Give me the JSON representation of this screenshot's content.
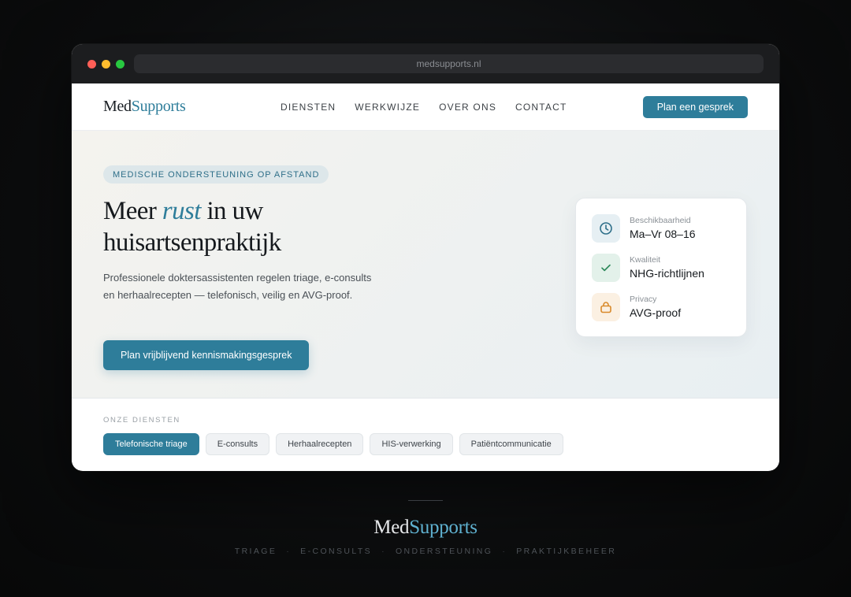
{
  "browser": {
    "url": "medsupports.nl"
  },
  "nav": {
    "logo_part1": "Med",
    "logo_part2": "Supports",
    "items": [
      {
        "label": "DIENSTEN"
      },
      {
        "label": "WERKWIJZE"
      },
      {
        "label": "OVER ONS"
      },
      {
        "label": "CONTACT"
      }
    ],
    "cta_label": "Plan een gesprek"
  },
  "hero": {
    "eyebrow": "MEDISCHE ONDERSTEUNING OP AFSTAND",
    "headline_pre": "Meer ",
    "headline_emph": "rust",
    "headline_post": " in uw huisartsenpraktijk",
    "lead": "Professionele doktersassistenten regelen triage, e-consults en herhaalrecepten — telefonisch, veilig en AVG-proof.",
    "cta_label": "Plan vrijblijvend kennismakingsgesprek"
  },
  "card": {
    "rows": [
      {
        "label": "Beschikbaarheid",
        "value": "Ma–Vr 08–16",
        "icon": "clock-icon"
      },
      {
        "label": "Kwaliteit",
        "value": "NHG-richtlijnen",
        "icon": "check-icon"
      },
      {
        "label": "Privacy",
        "value": "AVG-proof",
        "icon": "lock-icon"
      }
    ]
  },
  "services": {
    "label": "ONZE DIENSTEN",
    "chips": [
      {
        "label": "Telefonische triage"
      },
      {
        "label": "E-consults"
      },
      {
        "label": "Herhaalrecepten"
      },
      {
        "label": "HIS-verwerking"
      },
      {
        "label": "Patiëntcommunicatie"
      }
    ]
  },
  "footer": {
    "logo_part1": "Med",
    "logo_part2": "Supports",
    "tags": [
      "TRIAGE",
      "E-CONSULTS",
      "ONDERSTEUNING",
      "PRAKTIJKBEHEER"
    ]
  },
  "colors": {
    "accent": "#2e7d9a",
    "green": "#2f8a5c",
    "amber": "#d98a2b"
  }
}
